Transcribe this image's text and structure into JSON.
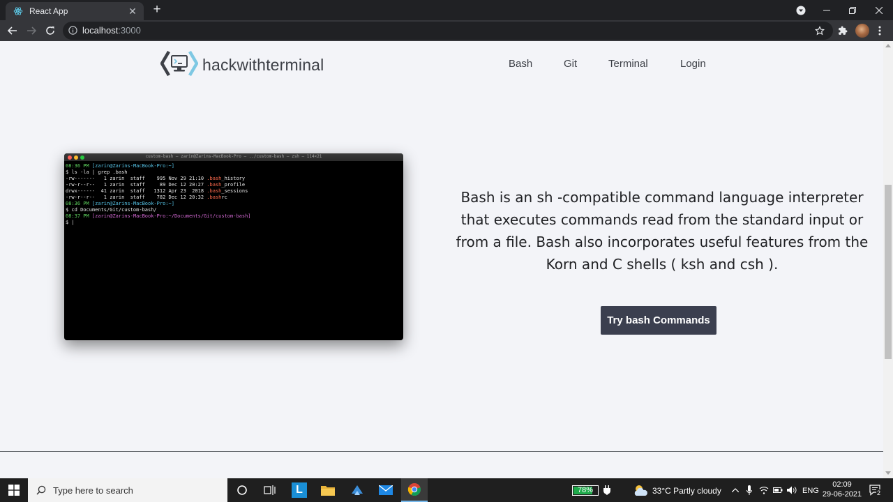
{
  "browser": {
    "tab_title": "React App",
    "url_host": "localhost",
    "url_port": ":3000"
  },
  "site": {
    "logo_text": "hackwithterminal",
    "nav": [
      "Bash",
      "Git",
      "Terminal",
      "Login"
    ]
  },
  "terminal": {
    "title": "custom-bash — zarin@Zarins-MacBook-Pro — ../custom-bash — zsh — 114×21",
    "lines": [
      [
        {
          "t": "08:36 PM ",
          "c": "green"
        },
        {
          "t": "[zarin@Zarins-MacBook-Pro:~]",
          "c": "cyan"
        }
      ],
      [
        {
          "t": "$ ls -la | grep .bash",
          "c": ""
        }
      ],
      [
        {
          "t": "-rw-------   1 zarin  staff    995 Nov 29 21:10 ",
          "c": ""
        },
        {
          "t": ".bash",
          "c": "red"
        },
        {
          "t": "_history",
          "c": ""
        }
      ],
      [
        {
          "t": "-rw-r--r--   1 zarin  staff     89 Dec 12 20:27 ",
          "c": ""
        },
        {
          "t": ".bash",
          "c": "red"
        },
        {
          "t": "_profile",
          "c": ""
        }
      ],
      [
        {
          "t": "drwx------  41 zarin  staff   1312 Apr 23  2018 ",
          "c": ""
        },
        {
          "t": ".bash",
          "c": "red"
        },
        {
          "t": "_sessions",
          "c": ""
        }
      ],
      [
        {
          "t": "-rw-r--r--   1 zarin  staff    782 Dec 12 20:32 ",
          "c": ""
        },
        {
          "t": ".bash",
          "c": "red"
        },
        {
          "t": "rc",
          "c": ""
        }
      ],
      [
        {
          "t": "08:36 PM ",
          "c": "green"
        },
        {
          "t": "[zarin@Zarins-MacBook-Pro:~]",
          "c": "cyan"
        }
      ],
      [
        {
          "t": "$ cd Documents/Git/custom-bash/",
          "c": ""
        }
      ],
      [
        {
          "t": "08:37 PM ",
          "c": "green"
        },
        {
          "t": "[zarin@Zarins-MacBook-Pro:~/Documents/Git/custom-bash]",
          "c": "magenta"
        }
      ],
      [
        {
          "t": "$ |",
          "c": ""
        }
      ]
    ]
  },
  "hero": {
    "description": "Bash is an sh -compatible command language interpreter that executes commands read from the standard input or from a file. Bash also incorporates useful features from the Korn and C shells ( ksh and csh ).",
    "button_label": "Try bash Commands"
  },
  "taskbar": {
    "search_placeholder": "Type here to search",
    "battery_percent": "78%",
    "battery_level": 0.78,
    "weather": "33°C  Partly cloudy",
    "language": "ENG",
    "time": "02:09",
    "date": "29-06-2021",
    "notification_count": "2",
    "app_l_label": "L"
  },
  "colors": {
    "button_bg": "#3b3f4f",
    "page_bg": "#f3f4f8",
    "logo_accent": "#7ec8e3",
    "logo_dark": "#3d4047"
  }
}
